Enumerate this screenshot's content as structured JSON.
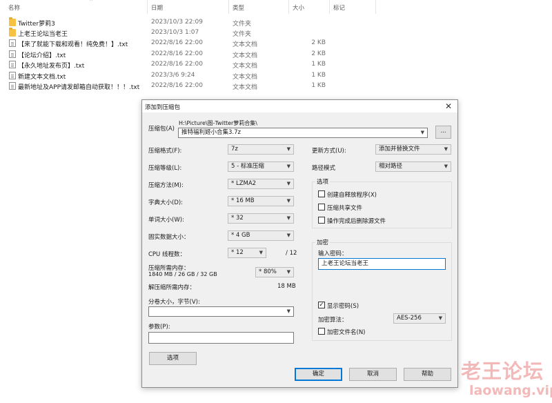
{
  "explorer": {
    "columns": {
      "name": "名称",
      "date": "日期",
      "type": "类型",
      "size": "大小",
      "tags": "标记"
    },
    "files": [
      {
        "icon": "folder-icon",
        "name": "Twitter萝莉3",
        "date": "2023/10/3 22:09",
        "type": "文件夹",
        "size": ""
      },
      {
        "icon": "folder-icon",
        "name": "上老王论坛当老王",
        "date": "2023/10/3 1:07",
        "type": "文件夹",
        "size": ""
      },
      {
        "icon": "txt-icon",
        "name": "【来了就能下载和观看！纯免费！】.txt",
        "date": "2022/8/16 22:00",
        "type": "文本文档",
        "size": "2 KB"
      },
      {
        "icon": "txt-icon",
        "name": "【论坛介绍】.txt",
        "date": "2022/8/16 22:00",
        "type": "文本文档",
        "size": "2 KB"
      },
      {
        "icon": "txt-icon",
        "name": "【永久地址发布页】.txt",
        "date": "2022/8/16 22:00",
        "type": "文本文档",
        "size": "1 KB"
      },
      {
        "icon": "txt-icon",
        "name": "新建文本文档.txt",
        "date": "2023/3/6 9:24",
        "type": "文本文档",
        "size": "1 KB"
      },
      {
        "icon": "txt-icon",
        "name": "最新地址及APP请发邮箱自动获取！！！.txt",
        "date": "2022/8/16 22:00",
        "type": "文本文档",
        "size": "1 KB"
      }
    ]
  },
  "dialog": {
    "title": "添加到压缩包",
    "close_glyph": "✕",
    "archive": {
      "label": "压缩包(A)",
      "path": "H:\\Picture\\图-Twitter萝莉合集\\",
      "filename": "推特福利姬小合集3.7z",
      "browse_label": "..."
    },
    "left": {
      "format_label": "压缩格式(F):",
      "format_value": "7z",
      "level_label": "压缩等级(L):",
      "level_value": "5 - 标准压缩",
      "method_label": "压缩方法(M):",
      "method_value": "* LZMA2",
      "dict_label": "字典大小(D):",
      "dict_value": "* 16 MB",
      "word_label": "单词大小(W):",
      "word_value": "* 32",
      "solid_label": "固实数据大小：",
      "solid_value": "* 4 GB",
      "cpu_label": "CPU 线程数：",
      "cpu_value": "* 12",
      "cpu_total": "/ 12",
      "mem_label": "压缩所需内存：",
      "mem_detail": "1840 MB / 26 GB / 32 GB",
      "mem_value": "* 80%",
      "decomp_label": "解压缩所需内存：",
      "decomp_value": "18 MB",
      "split_label": "分卷大小，字节(V):",
      "split_value": "",
      "params_label": "参数(P):",
      "params_value": "",
      "options_button": "选项"
    },
    "right": {
      "update_label": "更新方式(U):",
      "update_value": "添加并替换文件",
      "pathmode_label": "路径模式",
      "pathmode_value": "相对路径",
      "options_group": "选项",
      "opt_sfx": "创建自释放程序(X)",
      "opt_shared": "压缩共享文件",
      "opt_delete": "操作完成后删除源文件",
      "encryption_group": "加密",
      "password_label": "输入密码：",
      "password_value": "上老王论坛当老王",
      "show_password": "显示密码(S)",
      "enc_method_label": "加密算法：",
      "enc_method_value": "AES-256",
      "encrypt_names": "加密文件名(N)"
    },
    "buttons": {
      "ok": "确定",
      "cancel": "取消",
      "help": "帮助"
    }
  },
  "watermark": {
    "cn": "老王论坛",
    "en": "laowang.vip"
  },
  "colors": {
    "accent": "#0078d7",
    "folder": "#f5c244",
    "watermark": "#f3b9b9"
  }
}
